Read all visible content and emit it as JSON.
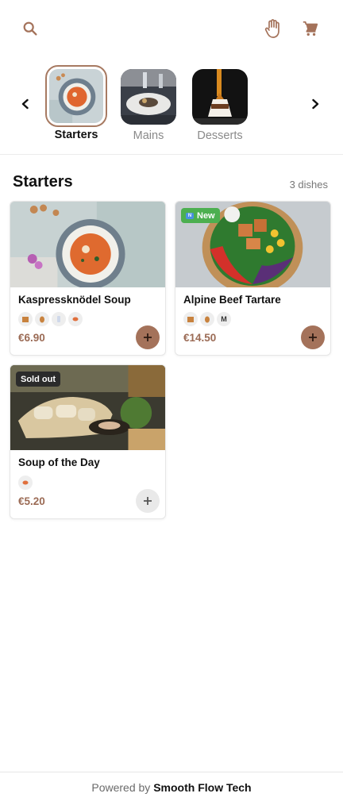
{
  "topbar": {
    "search_icon": "search-icon",
    "hand_icon": "hand-icon",
    "cart_icon": "cart-icon",
    "accent_color": "#a4725a"
  },
  "categories": [
    {
      "label": "Starters",
      "active": true
    },
    {
      "label": "Mains",
      "active": false
    },
    {
      "label": "Desserts",
      "active": false
    }
  ],
  "section": {
    "title": "Starters",
    "count": "3 dishes"
  },
  "dishes": [
    {
      "name": "Kaspressknödel Soup",
      "price": "€6.90",
      "badge": "",
      "allergens": [
        "box-icon",
        "egg-icon",
        "milk-icon",
        "fish-icon"
      ],
      "available": true
    },
    {
      "name": "Alpine Beef Tartare",
      "price": "€14.50",
      "badge": "New",
      "allergens": [
        "box-icon",
        "egg-icon",
        "M"
      ],
      "available": true
    },
    {
      "name": "Soup of the Day",
      "price": "€5.20",
      "badge": "Sold out",
      "allergens": [
        "fish-icon"
      ],
      "available": false
    }
  ],
  "footer": {
    "prefix": "Powered by",
    "brand": "Smooth Flow Tech"
  }
}
